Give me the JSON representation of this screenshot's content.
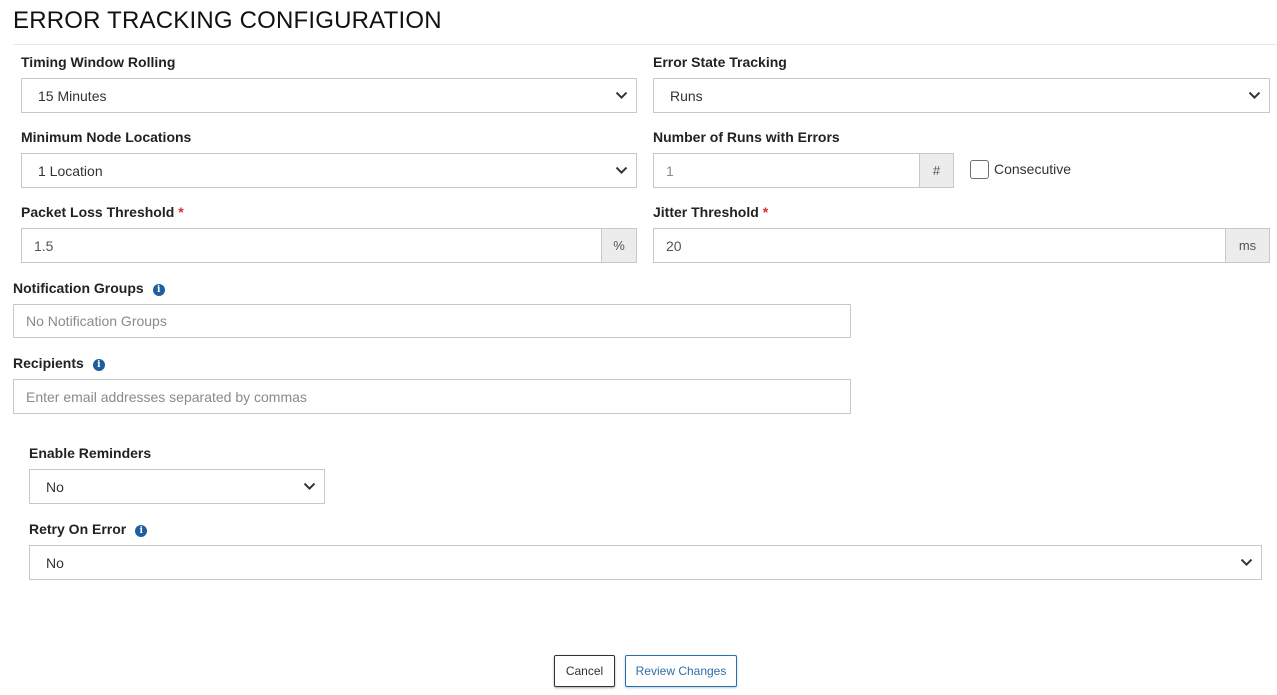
{
  "page": {
    "title": "ERROR TRACKING CONFIGURATION"
  },
  "timing_window": {
    "label": "Timing Window Rolling",
    "value": "15 Minutes"
  },
  "error_state": {
    "label": "Error State Tracking",
    "value": "Runs"
  },
  "min_nodes": {
    "label": "Minimum Node Locations",
    "value": "1 Location"
  },
  "runs_errors": {
    "label": "Number of Runs with Errors",
    "value": "1",
    "addon": "#",
    "consecutive_label": "Consecutive",
    "consecutive_checked": false
  },
  "packet_loss": {
    "label": "Packet Loss Threshold",
    "required": "*",
    "value": "1.5",
    "addon": "%"
  },
  "jitter": {
    "label": "Jitter Threshold",
    "required": "*",
    "value": "20",
    "addon": "ms"
  },
  "notification_groups": {
    "label": "Notification Groups",
    "placeholder": "No Notification Groups",
    "info_icon": "info-icon"
  },
  "recipients": {
    "label": "Recipients",
    "placeholder": "Enter email addresses separated by commas",
    "info_icon": "info-icon"
  },
  "reminders": {
    "label": "Enable Reminders",
    "value": "No"
  },
  "retry": {
    "label": "Retry On Error",
    "value": "No",
    "info_icon": "info-icon"
  },
  "buttons": {
    "cancel": "Cancel",
    "review": "Review Changes"
  },
  "colors": {
    "accent": "#2f6fa8",
    "required": "#d9302c",
    "info": "#1f5e9c",
    "border": "#c8c8c8",
    "addon_bg": "#ececec"
  }
}
